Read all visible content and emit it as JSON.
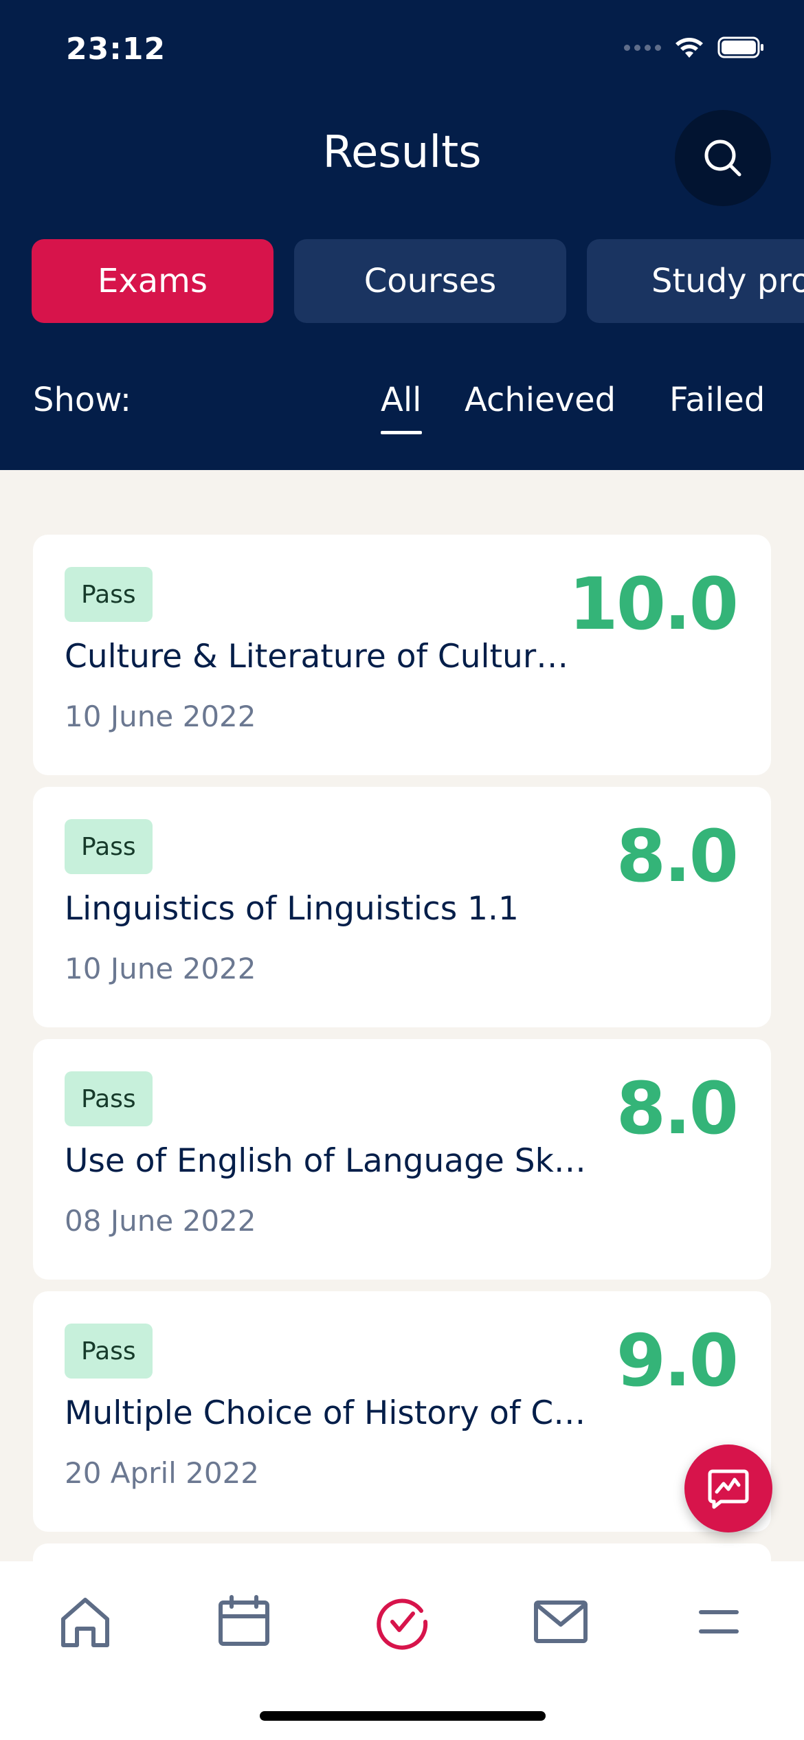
{
  "status_bar": {
    "time": "23:12"
  },
  "header": {
    "title": "Results"
  },
  "tabs": [
    {
      "label": "Exams",
      "active": true
    },
    {
      "label": "Courses",
      "active": false
    },
    {
      "label": "Study pro",
      "active": false
    }
  ],
  "filters": {
    "label": "Show:",
    "options": [
      {
        "label": "All",
        "active": true
      },
      {
        "label": "Achieved",
        "active": false
      },
      {
        "label": "Failed",
        "active": false
      }
    ]
  },
  "results": [
    {
      "status": "Pass",
      "course": "Culture & Literature of Cultur…",
      "date": "10 June 2022",
      "grade": "10.0"
    },
    {
      "status": "Pass",
      "course": "Linguistics of Linguistics 1.1",
      "date": "10 June 2022",
      "grade": "8.0"
    },
    {
      "status": "Pass",
      "course": "Use of English of Language Skil…",
      "date": "08 June 2022",
      "grade": "8.0"
    },
    {
      "status": "Pass",
      "course": "Multiple Choice of History of C…",
      "date": "20 April 2022",
      "grade": "9.0"
    }
  ],
  "icons": {
    "search": "search-icon",
    "fab": "feedback-icon",
    "nav": [
      "home-icon",
      "calendar-icon",
      "results-check-icon",
      "mail-icon",
      "menu-icon"
    ]
  },
  "colors": {
    "header_bg": "#041e49",
    "accent": "#d7144b",
    "pass_badge": "#c7f0db",
    "grade": "#34b478",
    "background": "#f6f3ee"
  }
}
